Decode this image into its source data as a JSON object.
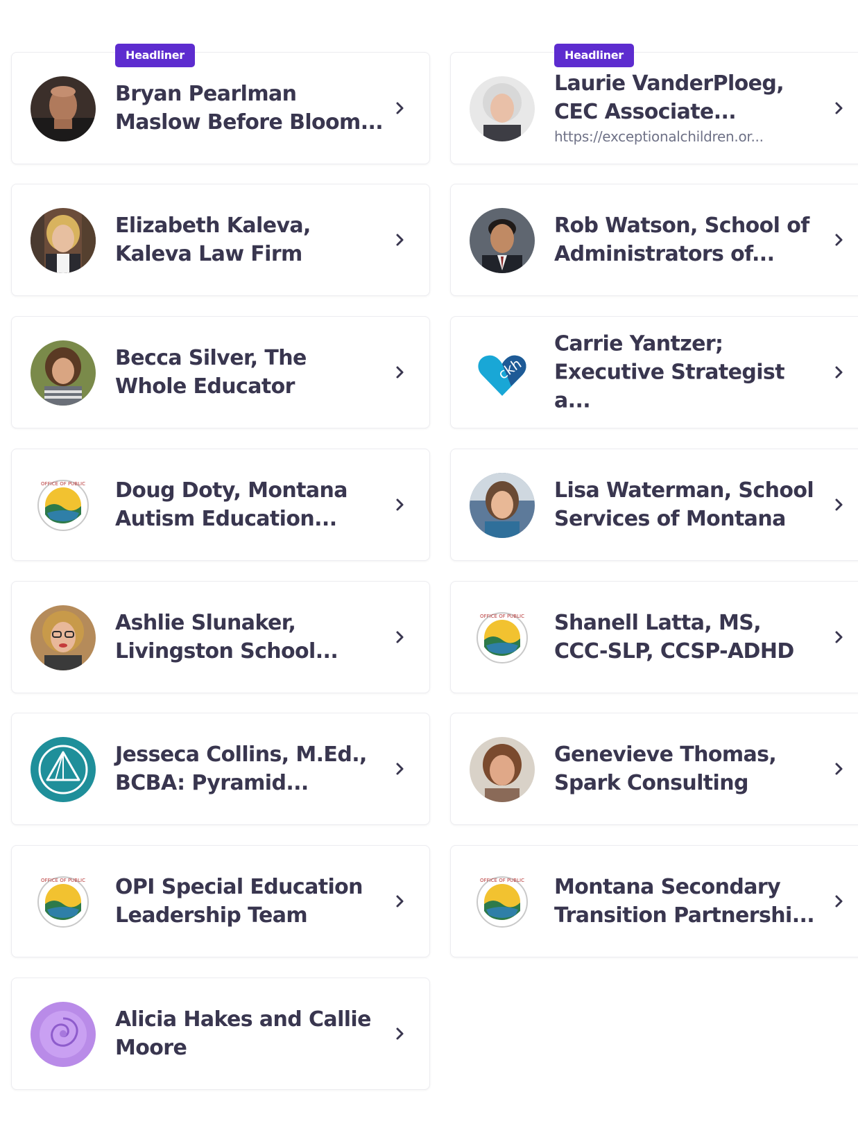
{
  "speakers": [
    {
      "badge": "Headliner",
      "name": "Bryan Pearlman\nMaslow Before Bloom...",
      "link": "",
      "avatar": "person-photo-avatar"
    },
    {
      "badge": "Headliner",
      "name": "Laurie VanderPloeg,\nCEC Associate...",
      "link": "https://exceptionalchildren.or...",
      "avatar": "person-photo-avatar"
    },
    {
      "badge": "",
      "name": "Elizabeth Kaleva,\nKaleva Law Firm",
      "link": "",
      "avatar": "person-photo-avatar"
    },
    {
      "badge": "",
      "name": "Rob Watson, School of\nAdministrators of...",
      "link": "",
      "avatar": "person-photo-avatar"
    },
    {
      "badge": "",
      "name": "Becca Silver, The\nWhole Educator",
      "link": "",
      "avatar": "person-photo-avatar"
    },
    {
      "badge": "",
      "name": "Carrie Yantzer;\nExecutive Strategist a...",
      "link": "",
      "avatar": "blue-heart-logo"
    },
    {
      "badge": "",
      "name": "Doug Doty, Montana\nAutism Education...",
      "link": "",
      "avatar": "montana-opi-seal-logo"
    },
    {
      "badge": "",
      "name": "Lisa Waterman, School\nServices of Montana",
      "link": "",
      "avatar": "person-photo-avatar"
    },
    {
      "badge": "",
      "name": "Ashlie Slunaker,\nLivingston School...",
      "link": "",
      "avatar": "person-photo-avatar"
    },
    {
      "badge": "",
      "name": "Shanell Latta, MS,\nCCC-SLP, CCSP-ADHD",
      "link": "",
      "avatar": "montana-opi-seal-logo"
    },
    {
      "badge": "",
      "name": "Jesseca Collins, M.Ed.,\nBCBA: Pyramid...",
      "link": "",
      "avatar": "pyramid-teal-logo"
    },
    {
      "badge": "",
      "name": "Genevieve Thomas,\nSpark Consulting",
      "link": "",
      "avatar": "person-photo-avatar"
    },
    {
      "badge": "",
      "name": "OPI Special Education\nLeadership Team",
      "link": "",
      "avatar": "montana-opi-seal-logo"
    },
    {
      "badge": "",
      "name": "Montana Secondary\nTransition Partnershi...",
      "link": "",
      "avatar": "montana-opi-seal-logo"
    },
    {
      "badge": "",
      "name": "Alicia Hakes and Callie\nMoore",
      "link": "",
      "avatar": "purple-rose-avatar"
    }
  ],
  "colors": {
    "badge": "#5d2ccf",
    "text": "#39364f",
    "link": "#6f7287"
  }
}
